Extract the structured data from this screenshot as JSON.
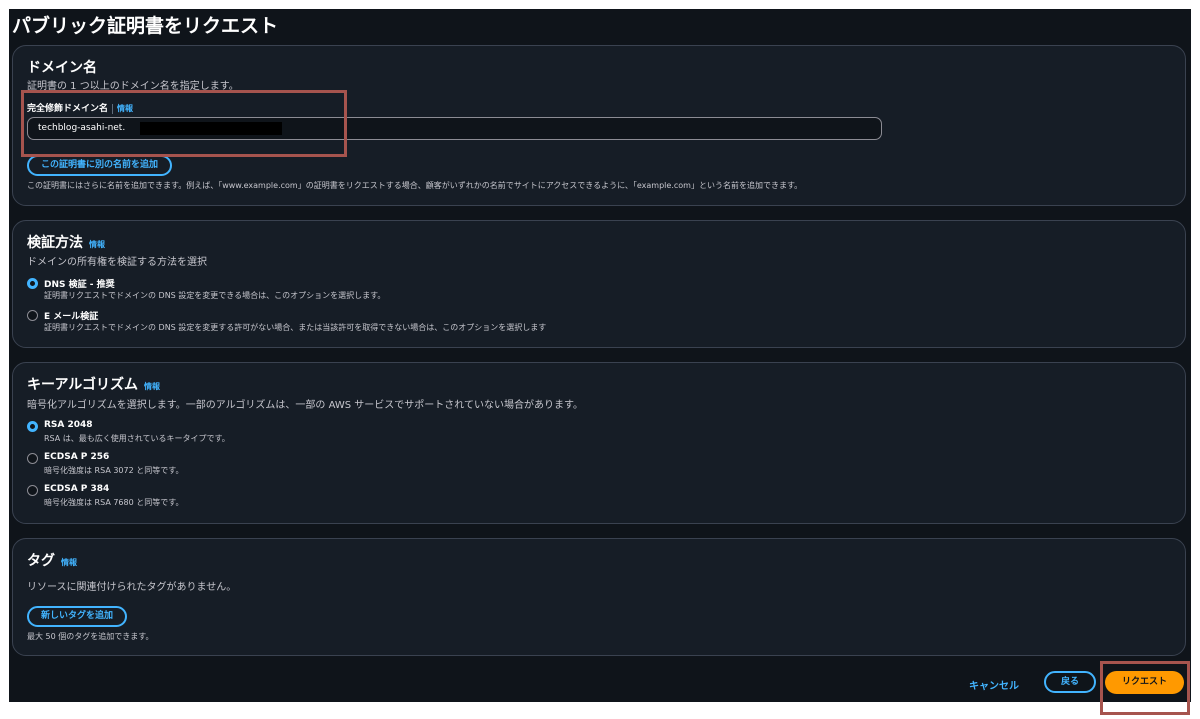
{
  "page": {
    "title": "パブリック証明書をリクエスト"
  },
  "domain_section": {
    "title": "ドメイン名",
    "description": "証明書の 1 つ以上のドメイン名を指定します。",
    "field_label": "完全修飾ドメイン名",
    "info": "情報",
    "input_value": "techblog-asahi-net.",
    "add_name_button": "この証明書に別の名前を追加",
    "hint": "この証明書にはさらに名前を追加できます。例えば、「www.example.com」の証明書をリクエストする場合、顧客がいずれかの名前でサイトにアクセスできるように、「example.com」という名前を追加できます。"
  },
  "validation_section": {
    "title": "検証方法",
    "info": "情報",
    "description": "ドメインの所有権を検証する方法を選択",
    "options": [
      {
        "label": "DNS 検証 - 推奨",
        "desc": "証明書リクエストでドメインの DNS 設定を変更できる場合は、このオプションを選択します。",
        "checked": true
      },
      {
        "label": "E メール検証",
        "desc": "証明書リクエストでドメインの DNS 設定を変更する許可がない場合、または当該許可を取得できない場合は、このオプションを選択します",
        "checked": false
      }
    ]
  },
  "key_section": {
    "title": "キーアルゴリズム",
    "info": "情報",
    "description": "暗号化アルゴリズムを選択します。一部のアルゴリズムは、一部の AWS サービスでサポートされていない場合があります。",
    "options": [
      {
        "label": "RSA 2048",
        "desc": "RSA は、最も広く使用されているキータイプです。",
        "checked": true
      },
      {
        "label": "ECDSA P 256",
        "desc": "暗号化強度は RSA 3072 と同等です。",
        "checked": false
      },
      {
        "label": "ECDSA P 384",
        "desc": "暗号化強度は RSA 7680 と同等です。",
        "checked": false
      }
    ]
  },
  "tags_section": {
    "title": "タグ",
    "info": "情報",
    "empty_message": "リソースに関連付けられたタグがありません。",
    "add_tag_button": "新しいタグを追加",
    "hint": "最大 50 個のタグを追加できます。"
  },
  "footer": {
    "cancel": "キャンセル",
    "back": "戻る",
    "request": "リクエスト"
  },
  "colors": {
    "background": "#0f141a",
    "card": "#161d26",
    "link": "#42b4ff",
    "primary": "#ff9900",
    "highlight": "#a6544e"
  }
}
